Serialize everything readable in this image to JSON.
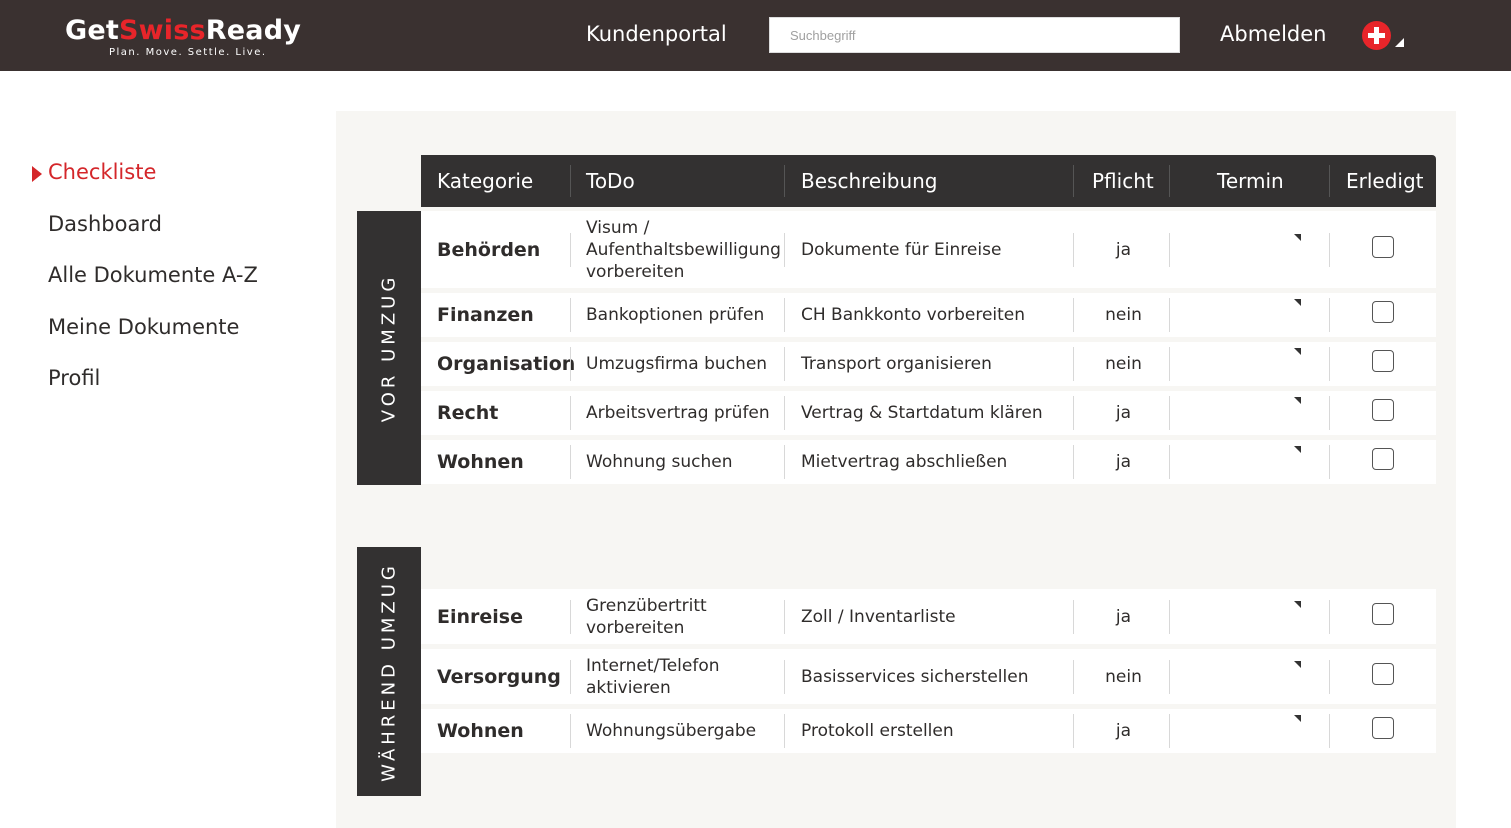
{
  "header": {
    "logo_prefix": "Get",
    "logo_accent": "Swiss",
    "logo_suffix": "Ready",
    "logo_tagline": "Plan. Move. Settle. Live.",
    "portal_title": "Kundenportal",
    "search_placeholder": "Suchbegriff",
    "logout_label": "Abmelden",
    "language_icon": "swiss-flag-icon"
  },
  "sidebar": {
    "items": [
      {
        "label": "Checkliste",
        "active": true
      },
      {
        "label": "Dashboard",
        "active": false
      },
      {
        "label": "Alle Dokumente A-Z",
        "active": false
      },
      {
        "label": "Meine Dokumente",
        "active": false
      },
      {
        "label": "Profil",
        "active": false
      }
    ]
  },
  "table": {
    "columns": [
      "Kategorie",
      "ToDo",
      "Beschreibung",
      "Pflicht",
      "Termin",
      "Erledigt"
    ],
    "sections": [
      {
        "label": "VOR UMZUG",
        "rows": [
          {
            "kategorie": "Behörden",
            "todo": "Visum / Aufenthaltsbewilligung vorbereiten",
            "beschreibung": "Dokumente für Einreise",
            "pflicht": "ja",
            "erledigt": false
          },
          {
            "kategorie": "Finanzen",
            "todo": "Bankoptionen prüfen",
            "beschreibung": "CH Bankkonto vorbereiten",
            "pflicht": "nein",
            "erledigt": false
          },
          {
            "kategorie": "Organisation",
            "todo": "Umzugsfirma buchen",
            "beschreibung": "Transport organisieren",
            "pflicht": "nein",
            "erledigt": false
          },
          {
            "kategorie": "Recht",
            "todo": "Arbeitsvertrag prüfen",
            "beschreibung": "Vertrag & Startdatum klären",
            "pflicht": "ja",
            "erledigt": false
          },
          {
            "kategorie": "Wohnen",
            "todo": "Wohnung suchen",
            "beschreibung": "Mietvertrag abschließen",
            "pflicht": "ja",
            "erledigt": false
          }
        ]
      },
      {
        "label": "WÄHREND UMZUG",
        "rows": [
          {
            "kategorie": "Einreise",
            "todo": "Grenzübertritt vorbereiten",
            "beschreibung": "Zoll / Inventarliste",
            "pflicht": "ja",
            "erledigt": false
          },
          {
            "kategorie": "Versorgung",
            "todo": "Internet/Telefon aktivieren",
            "beschreibung": "Basisservices sicherstellen",
            "pflicht": "nein",
            "erledigt": false
          },
          {
            "kategorie": "Wohnen",
            "todo": "Wohnungsübergabe",
            "beschreibung": "Protokoll erstellen",
            "pflicht": "ja",
            "erledigt": false
          }
        ]
      }
    ]
  },
  "colors": {
    "header_bg": "#3a3130",
    "accent_red": "#d4262a",
    "table_header_bg": "#333131",
    "panel_bg": "#f7f6f3"
  }
}
